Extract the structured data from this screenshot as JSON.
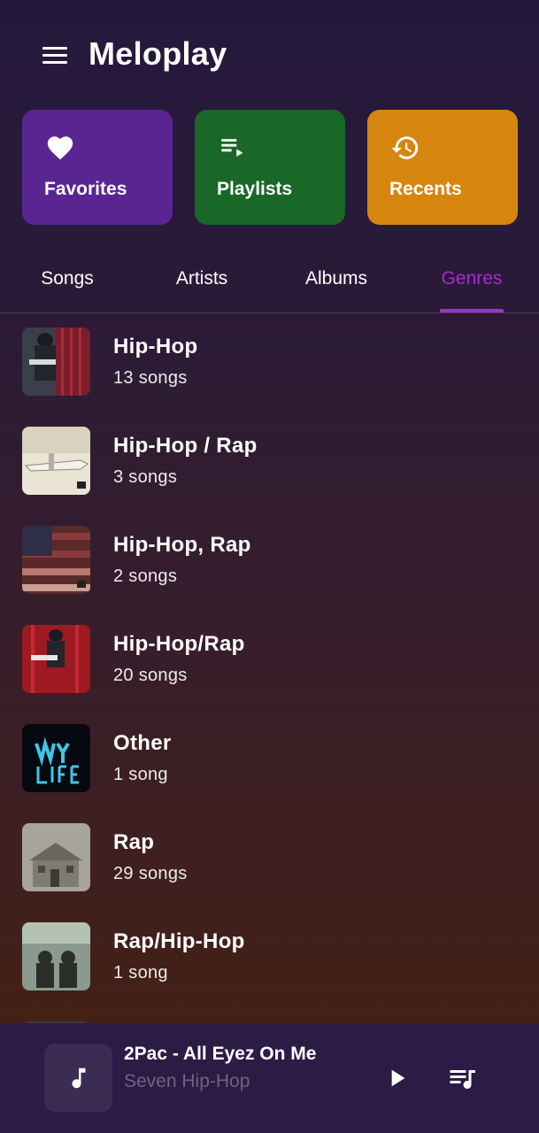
{
  "app": {
    "title": "Meloplay",
    "menu_icon": "menu-icon"
  },
  "quick_cards": [
    {
      "label": "Favorites",
      "icon": "heart-icon",
      "color": "#5a2591"
    },
    {
      "label": "Playlists",
      "icon": "playlist-play-icon",
      "color": "#196828"
    },
    {
      "label": "Recents",
      "icon": "history-icon",
      "color": "#d6850f"
    }
  ],
  "tabs": [
    {
      "label": "Songs"
    },
    {
      "label": "Artists"
    },
    {
      "label": "Albums"
    },
    {
      "label": "Genres",
      "active": true
    }
  ],
  "colors": {
    "accent": "#a72bd2",
    "player_bg": "#2b1b45"
  },
  "genres": [
    {
      "name": "Hip-Hop",
      "count": "13 songs"
    },
    {
      "name": "Hip-Hop / Rap",
      "count": "3 songs"
    },
    {
      "name": "Hip-Hop, Rap",
      "count": "2 songs"
    },
    {
      "name": "Hip-Hop/Rap",
      "count": "20 songs"
    },
    {
      "name": "Other",
      "count": "1 song"
    },
    {
      "name": "Rap",
      "count": "29 songs"
    },
    {
      "name": "Rap/Hip-Hop",
      "count": "1 song"
    }
  ],
  "now_playing": {
    "title": "2Pac - All Eyez On Me",
    "artist": "Seven Hip-Hop",
    "art_icon": "music-note-icon",
    "play_icon": "play-icon",
    "queue_icon": "queue-music-icon"
  }
}
